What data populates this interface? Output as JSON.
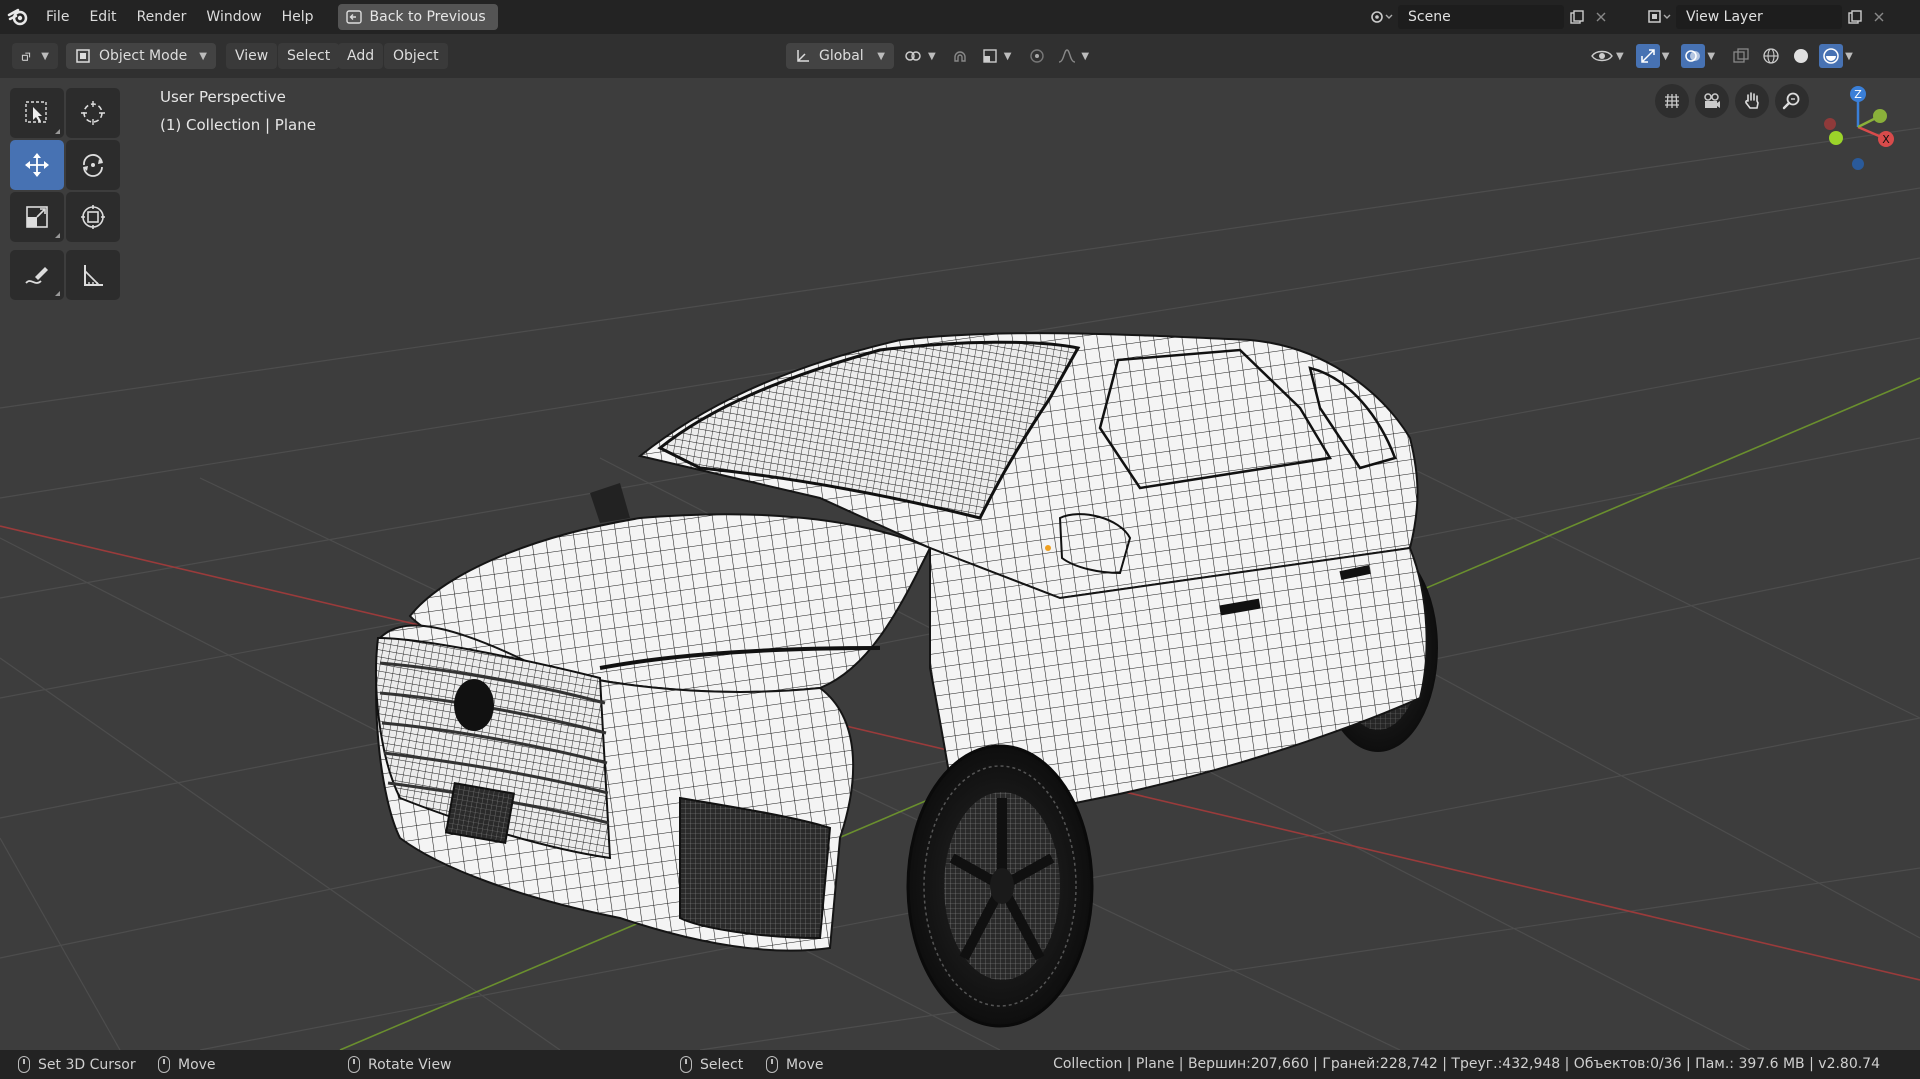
{
  "menu": {
    "items": [
      "File",
      "Edit",
      "Render",
      "Window",
      "Help"
    ],
    "back_button": "Back to Previous"
  },
  "scene": {
    "name": "Scene",
    "view_layer": "View Layer"
  },
  "header": {
    "mode": "Object Mode",
    "view": "View",
    "select": "Select",
    "add": "Add",
    "object": "Object",
    "orientation": "Global"
  },
  "viewport": {
    "perspective_label": "User Perspective",
    "collection_label": "(1) Collection | Plane",
    "gizmo": {
      "z": "Z",
      "x": "X"
    }
  },
  "status": {
    "set_cursor": "Set 3D Cursor",
    "move1": "Move",
    "rotate": "Rotate View",
    "select": "Select",
    "move2": "Move",
    "stats": "Collection | Plane | Вершин:207,660 | Граней:228,742 | Треуг.:432,948 | Объектов:0/36 | Пам.: 397.6 MB | v2.80.74"
  },
  "icons": {
    "tools": [
      "select-box-icon",
      "cursor-icon",
      "move-icon",
      "rotate-icon",
      "scale-icon",
      "transform-icon",
      "annotate-icon",
      "measure-icon"
    ],
    "nav": [
      "grid-view-icon",
      "camera-icon",
      "hand-pan-icon",
      "zoom-icon"
    ]
  },
  "colors": {
    "accent": "#4772b3",
    "x_axis": "#d84b4b",
    "y_axis": "#8ab03a",
    "z_axis": "#3a7fd8"
  }
}
